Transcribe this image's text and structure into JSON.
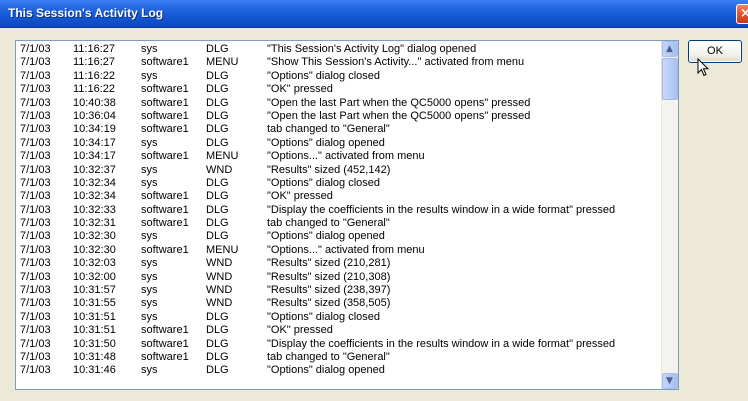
{
  "window": {
    "title": "This Session's Activity Log",
    "close_label": "×"
  },
  "ok_button": {
    "label": "OK"
  },
  "scrollbar": {
    "up_arrow": "▲",
    "down_arrow": "▼"
  },
  "log": {
    "rows": [
      [
        "7/1/03",
        "11:16:27",
        "sys",
        "DLG",
        "\"This Session's Activity Log\" dialog opened"
      ],
      [
        "7/1/03",
        "11:16:27",
        "software1",
        "MENU",
        "\"Show This Session's Activity...\" activated from menu"
      ],
      [
        "7/1/03",
        "11:16:22",
        "sys",
        "DLG",
        "\"Options\" dialog closed"
      ],
      [
        "7/1/03",
        "11:16:22",
        "software1",
        "DLG",
        "\"OK\" pressed"
      ],
      [
        "7/1/03",
        "10:40:38",
        "software1",
        "DLG",
        "\"Open the last Part when the QC5000 opens\" pressed"
      ],
      [
        "7/1/03",
        "10:36:04",
        "software1",
        "DLG",
        "\"Open the last Part when the QC5000 opens\" pressed"
      ],
      [
        "7/1/03",
        "10:34:19",
        "software1",
        "DLG",
        "tab changed to \"General\""
      ],
      [
        "7/1/03",
        "10:34:17",
        "sys",
        "DLG",
        "\"Options\" dialog opened"
      ],
      [
        "7/1/03",
        "10:34:17",
        "software1",
        "MENU",
        "\"Options...\" activated from menu"
      ],
      [
        "7/1/03",
        "10:32:37",
        "sys",
        "WND",
        "\"Results\" sized (452,142)"
      ],
      [
        "7/1/03",
        "10:32:34",
        "sys",
        "DLG",
        "\"Options\" dialog closed"
      ],
      [
        "7/1/03",
        "10:32:34",
        "software1",
        "DLG",
        "\"OK\" pressed"
      ],
      [
        "7/1/03",
        "10:32:33",
        "software1",
        "DLG",
        "\"Display the coefficients in the results window in a wide format\" pressed"
      ],
      [
        "7/1/03",
        "10:32:31",
        "software1",
        "DLG",
        "tab changed to \"General\""
      ],
      [
        "7/1/03",
        "10:32:30",
        "sys",
        "DLG",
        "\"Options\" dialog opened"
      ],
      [
        "7/1/03",
        "10:32:30",
        "software1",
        "MENU",
        "\"Options...\" activated from menu"
      ],
      [
        "7/1/03",
        "10:32:03",
        "sys",
        "WND",
        "\"Results\" sized (210,281)"
      ],
      [
        "7/1/03",
        "10:32:00",
        "sys",
        "WND",
        "\"Results\" sized (210,308)"
      ],
      [
        "7/1/03",
        "10:31:57",
        "sys",
        "WND",
        "\"Results\" sized (238,397)"
      ],
      [
        "7/1/03",
        "10:31:55",
        "sys",
        "WND",
        "\"Results\" sized (358,505)"
      ],
      [
        "7/1/03",
        "10:31:51",
        "sys",
        "DLG",
        "\"Options\" dialog closed"
      ],
      [
        "7/1/03",
        "10:31:51",
        "software1",
        "DLG",
        "\"OK\" pressed"
      ],
      [
        "7/1/03",
        "10:31:50",
        "software1",
        "DLG",
        "\"Display the coefficients in the results window in a wide format\" pressed"
      ],
      [
        "7/1/03",
        "10:31:48",
        "software1",
        "DLG",
        "tab changed to \"General\""
      ],
      [
        "7/1/03",
        "10:31:46",
        "sys",
        "DLG",
        "\"Options\" dialog opened"
      ]
    ]
  }
}
